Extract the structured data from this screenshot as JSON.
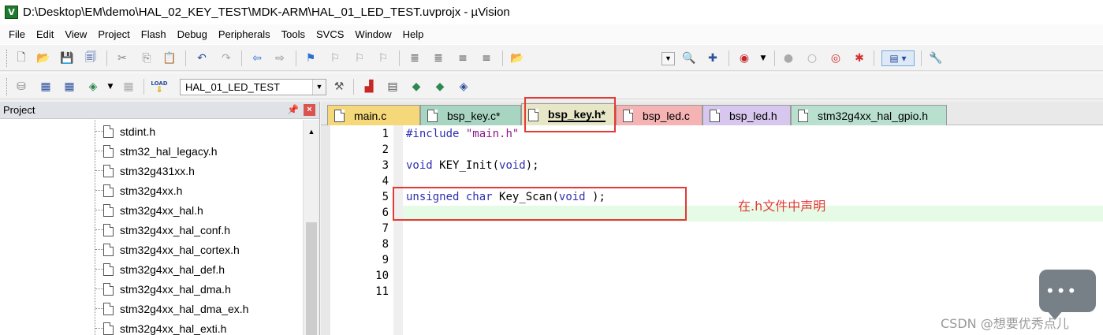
{
  "window": {
    "title": "D:\\Desktop\\EM\\demo\\HAL_02_KEY_TEST\\MDK-ARM\\HAL_01_LED_TEST.uvprojx - µVision",
    "app_icon_text": "V"
  },
  "menu": [
    "File",
    "Edit",
    "View",
    "Project",
    "Flash",
    "Debug",
    "Peripherals",
    "Tools",
    "SVCS",
    "Window",
    "Help"
  ],
  "toolbar2": {
    "target": "HAL_01_LED_TEST",
    "load_label": "LOAD"
  },
  "project_panel": {
    "title": "Project",
    "files": [
      "stdint.h",
      "stm32_hal_legacy.h",
      "stm32g431xx.h",
      "stm32g4xx.h",
      "stm32g4xx_hal.h",
      "stm32g4xx_hal_conf.h",
      "stm32g4xx_hal_cortex.h",
      "stm32g4xx_hal_def.h",
      "stm32g4xx_hal_dma.h",
      "stm32g4xx_hal_dma_ex.h",
      "stm32g4xx_hal_exti.h"
    ]
  },
  "tabs": [
    {
      "label": "main.c",
      "color": "#f5d87a"
    },
    {
      "label": "bsp_key.c*",
      "color": "#a8d5c2"
    },
    {
      "label": "bsp_key.h*",
      "color": "#e7e7c8",
      "active": true
    },
    {
      "label": "bsp_led.c",
      "color": "#f5b3b3"
    },
    {
      "label": "bsp_led.h",
      "color": "#d7c7ef"
    },
    {
      "label": "stm32g4xx_hal_gpio.h",
      "color": "#b9e0cf"
    }
  ],
  "line_numbers": [
    "1",
    "2",
    "3",
    "4",
    "5",
    "6",
    "7",
    "8",
    "9",
    "10",
    "11"
  ],
  "code": {
    "line1": {
      "kw": "#include",
      "str": "\"main.h\""
    },
    "line3": {
      "kw1": "void",
      "name": "KEY_Init(",
      "kw2": "void",
      "end": ");"
    },
    "line5": {
      "kw1": "unsigned",
      "kw2": "char",
      "name": "Key_Scan(",
      "kw3": "void",
      "end": " );"
    }
  },
  "annotation": "在.h文件中声明",
  "watermark": "CSDN @想要优秀点儿"
}
